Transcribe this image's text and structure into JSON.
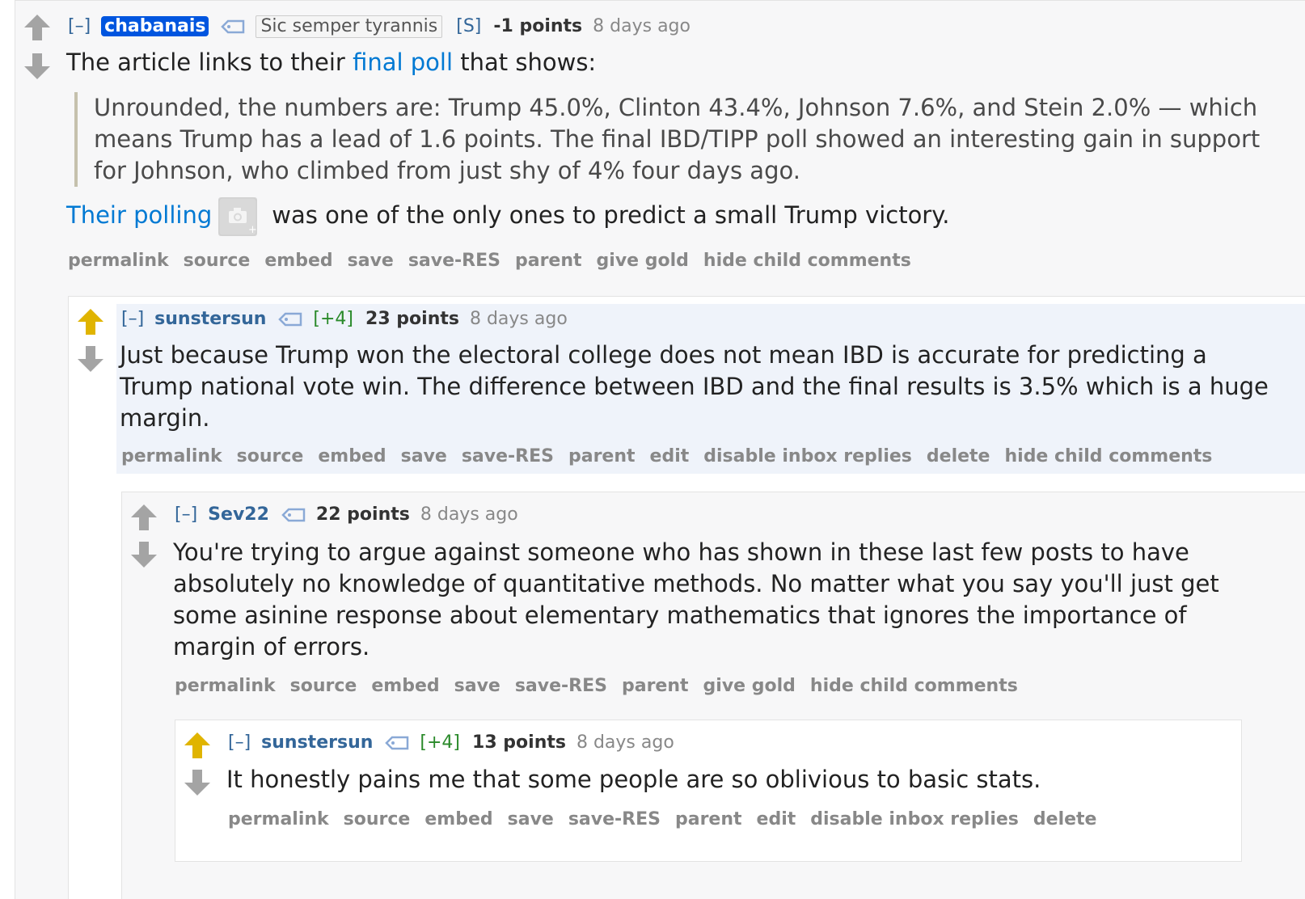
{
  "comments": [
    {
      "expand": "[–]",
      "author": "chabanais",
      "flair": "Sic semper tyrannis",
      "badge": "[S]",
      "score": "-1 points",
      "time": "8 days ago",
      "body_pre": "The article links to their ",
      "body_link": "final poll",
      "body_post": " that shows:",
      "quote": "Unrounded, the numbers are: Trump 45.0%, Clinton 43.4%, Johnson 7.6%, and Stein 2.0% — which means Trump has a lead of 1.6 points. The final IBD/TIPP poll showed an interesting gain in support for Johnson, who climbed from just shy of 4% four days ago.",
      "body2_link": "Their polling",
      "body2_post": "was one of the only ones to predict a small Trump victory.",
      "actions": [
        "permalink",
        "source",
        "embed",
        "save",
        "save-RES",
        "parent",
        "give gold",
        "hide child comments"
      ]
    },
    {
      "expand": "[–]",
      "author": "sunstersun",
      "vote_tag": "[+4]",
      "score": "23 points",
      "time": "8 days ago",
      "body": "Just because Trump won the electoral college does not mean IBD is accurate for predicting a Trump national vote win. The difference between IBD and the final results is 3.5% which is a huge margin.",
      "actions": [
        "permalink",
        "source",
        "embed",
        "save",
        "save-RES",
        "parent",
        "edit",
        "disable inbox replies",
        "delete",
        "hide child comments"
      ]
    },
    {
      "expand": "[–]",
      "author": "Sev22",
      "score": "22 points",
      "time": "8 days ago",
      "body": "You're trying to argue against someone who has shown in these last few posts to have absolutely no knowledge of quantitative methods. No matter what you say you'll just get some asinine response about elementary mathematics that ignores the importance of margin of errors.",
      "actions": [
        "permalink",
        "source",
        "embed",
        "save",
        "save-RES",
        "parent",
        "give gold",
        "hide child comments"
      ]
    },
    {
      "expand": "[–]",
      "author": "sunstersun",
      "vote_tag": "[+4]",
      "score": "13 points",
      "time": "8 days ago",
      "body": "It honestly pains me that some people are so oblivious to basic stats.",
      "actions": [
        "permalink",
        "source",
        "embed",
        "save",
        "save-RES",
        "parent",
        "edit",
        "disable inbox replies",
        "delete"
      ]
    }
  ],
  "colors": {
    "upvoted": "#e0b400",
    "neutral_arrow": "#a4a4a4",
    "link": "#0079d3",
    "author": "#336699"
  }
}
